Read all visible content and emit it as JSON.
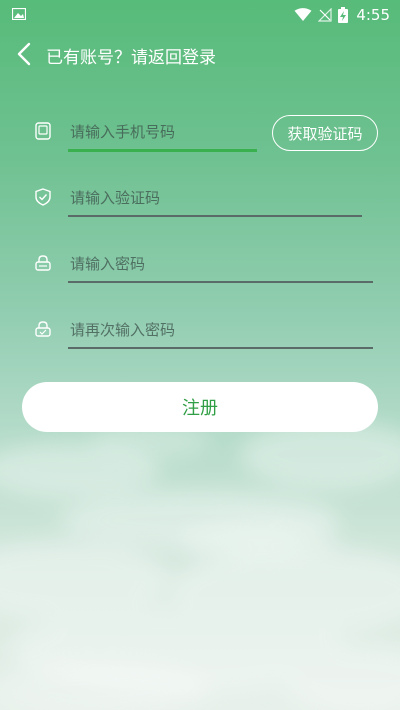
{
  "status_bar": {
    "time": "4:55",
    "icons": [
      "gallery-icon",
      "wifi-icon",
      "no-sim-icon",
      "battery-charging-icon"
    ]
  },
  "header": {
    "back_icon": "chevron-left-icon",
    "title": "已有账号？请返回登录"
  },
  "form": {
    "phone": {
      "placeholder": "请输入手机号码",
      "value": "",
      "icon": "phone-icon"
    },
    "get_code_label": "获取验证码",
    "code": {
      "placeholder": "请输入验证码",
      "value": "",
      "icon": "shield-icon"
    },
    "password": {
      "placeholder": "请输入密码",
      "value": "",
      "icon": "lock-icon"
    },
    "confirm_password": {
      "placeholder": "请再次输入密码",
      "value": "",
      "icon": "lock-check-icon"
    }
  },
  "register_label": "注册",
  "colors": {
    "accent_green": "#3ab04f",
    "button_text": "#2f9e44",
    "background_top": "#57bb79",
    "background_bottom": "#e7f0ea"
  }
}
